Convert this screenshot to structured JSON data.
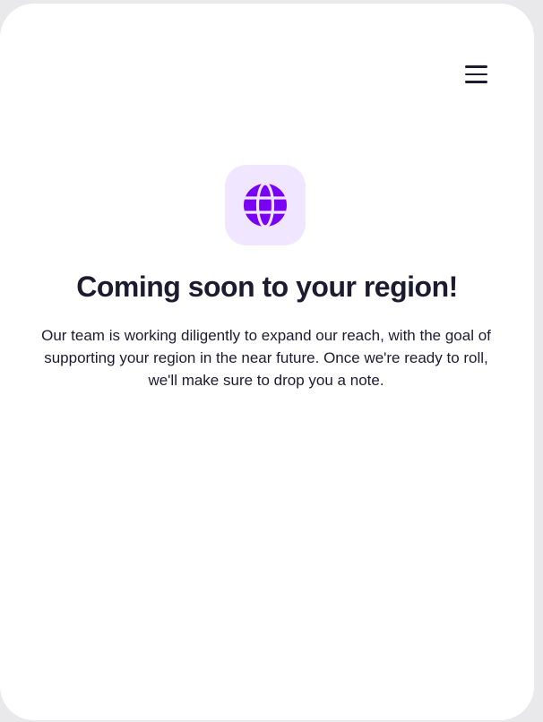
{
  "header": {
    "menu_icon": "hamburger-menu-icon"
  },
  "hero": {
    "icon": "globe-icon",
    "icon_color": "#7a00f5",
    "tile_color": "#f1e6ff",
    "title": "Coming soon to your region!",
    "description": "Our team is working diligently to expand our reach, with the goal of supporting your region in the near future. Once we're ready to roll, we'll make sure to drop you a note."
  },
  "colors": {
    "text": "#1d1b2f",
    "accent": "#7a00f5",
    "background": "#ffffff"
  }
}
